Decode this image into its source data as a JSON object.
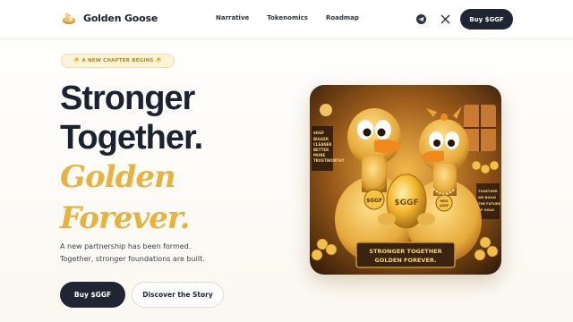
{
  "header": {
    "brand_name": "Golden Goose",
    "logo_icon": "goose-egg-logo-icon",
    "nav": [
      "Narrative",
      "Tokenomics",
      "Roadmap"
    ],
    "social_icons": [
      "telegram-icon",
      "x-icon"
    ],
    "buy_label": "Buy $GGF"
  },
  "hero": {
    "badge": "🐣 A NEW CHAPTER BEGINS 🐣",
    "title_line1": "Stronger",
    "title_line2": "Together.",
    "gold_line1": "Golden",
    "gold_line2": "Forever.",
    "desc_line1": "A new partnership has been formed.",
    "desc_line2": "Together, stronger foundations are built.",
    "primary_button": "Buy $GGF",
    "secondary_button": "Discover the Story"
  },
  "artwork": {
    "egg_text": "$GGF",
    "left_medal": "$GGF",
    "right_medal_line1": "MRS",
    "right_medal_line2": "$GGF",
    "left_sign": [
      "$GGF",
      "BIGGER",
      "CLEANER",
      "BETTER",
      "MORE",
      "TRUSTWORTHY"
    ],
    "right_sign": [
      "TOGETHER",
      "WE BUILD",
      "THE FUTURE",
      "OF GOLD"
    ],
    "plaque_line1": "STRONGER TOGETHER",
    "plaque_line2": "GOLDEN FOREVER."
  },
  "colors": {
    "dark": "#1f2533",
    "gold": "#e9b23e",
    "badge_bg": "#fdf3d9",
    "badge_text": "#b98417"
  }
}
